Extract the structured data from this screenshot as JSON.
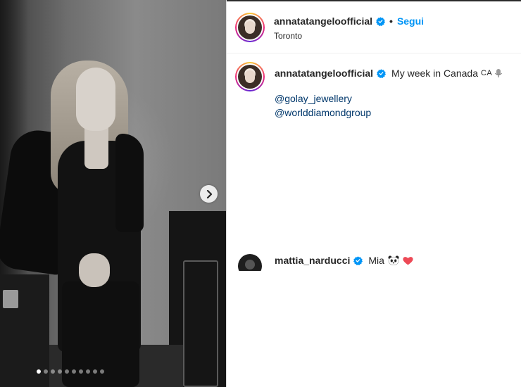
{
  "post": {
    "username": "annatatangeloofficial",
    "follow_label": "Segui",
    "separator": "•",
    "location": "Toronto",
    "verified": true
  },
  "caption": {
    "username": "annatatangeloofficial",
    "text": "My week in Canada",
    "flag_text": "CA",
    "mentions": [
      "@golay_jewellery",
      "@worlddiamondgroup"
    ]
  },
  "comment": {
    "username": "mattia_narducci",
    "text": "Mia",
    "emojis": [
      "panda-icon",
      "red-heart-icon"
    ]
  },
  "carousel": {
    "total_slides": 10,
    "active_index": 0
  },
  "colors": {
    "accent_blue": "#0095f6",
    "mention_blue": "#00376b",
    "heart_red": "#ed4956",
    "text": "#262626"
  }
}
